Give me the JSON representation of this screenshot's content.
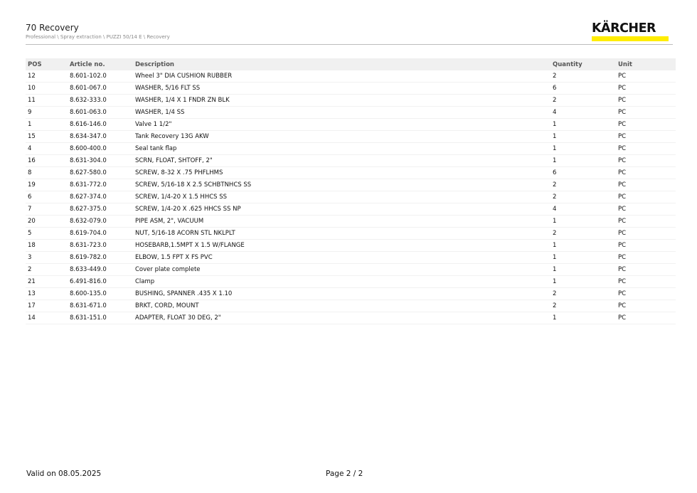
{
  "header": {
    "title": "70 Recovery",
    "breadcrumb": "Professional \\ Spray extraction \\ PUZZI 50/14 E \\ Recovery",
    "logo_text": "KÄRCHER",
    "brand_yellow": "#ffed00"
  },
  "table": {
    "columns": [
      "POS",
      "Article no.",
      "Description",
      "Quantity",
      "Unit"
    ],
    "rows": [
      [
        "12",
        "8.601-102.0",
        "Wheel 3\" DIA CUSHION RUBBER",
        "2",
        "PC"
      ],
      [
        "10",
        "8.601-067.0",
        "WASHER, 5/16 FLT SS",
        "6",
        "PC"
      ],
      [
        "11",
        "8.632-333.0",
        "WASHER, 1/4 X 1 FNDR ZN BLK",
        "2",
        "PC"
      ],
      [
        "9",
        "8.601-063.0",
        "WASHER, 1/4 SS",
        "4",
        "PC"
      ],
      [
        "1",
        "8.616-146.0",
        "Valve 1 1/2\"",
        "1",
        "PC"
      ],
      [
        "15",
        "8.634-347.0",
        "Tank Recovery 13G AKW",
        "1",
        "PC"
      ],
      [
        "4",
        "8.600-400.0",
        "Seal tank flap",
        "1",
        "PC"
      ],
      [
        "16",
        "8.631-304.0",
        "SCRN, FLOAT, SHTOFF, 2\"",
        "1",
        "PC"
      ],
      [
        "8",
        "8.627-580.0",
        "SCREW, 8-32 X .75 PHFLHMS",
        "6",
        "PC"
      ],
      [
        "19",
        "8.631-772.0",
        "SCREW, 5/16-18 X 2.5 SCHBTNHCS SS",
        "2",
        "PC"
      ],
      [
        "6",
        "8.627-374.0",
        "SCREW, 1/4-20 X 1.5 HHCS SS",
        "2",
        "PC"
      ],
      [
        "7",
        "8.627-375.0",
        "SCREW, 1/4-20 X .625 HHCS SS NP",
        "4",
        "PC"
      ],
      [
        "20",
        "8.632-079.0",
        "PIPE ASM, 2\", VACUUM",
        "1",
        "PC"
      ],
      [
        "5",
        "8.619-704.0",
        "NUT, 5/16-18 ACORN STL NKLPLT",
        "2",
        "PC"
      ],
      [
        "18",
        "8.631-723.0",
        "HOSEBARB,1.5MPT X 1.5 W/FLANGE",
        "1",
        "PC"
      ],
      [
        "3",
        "8.619-782.0",
        "ELBOW, 1.5 FPT X FS PVC",
        "1",
        "PC"
      ],
      [
        "2",
        "8.633-449.0",
        "Cover plate complete",
        "1",
        "PC"
      ],
      [
        "21",
        "6.491-816.0",
        "Clamp",
        "1",
        "PC"
      ],
      [
        "13",
        "8.600-135.0",
        "BUSHING, SPANNER .435 X 1.10",
        "2",
        "PC"
      ],
      [
        "17",
        "8.631-671.0",
        "BRKT, CORD, MOUNT",
        "2",
        "PC"
      ],
      [
        "14",
        "8.631-151.0",
        "ADAPTER, FLOAT 30 DEG, 2\"",
        "1",
        "PC"
      ]
    ]
  },
  "footer": {
    "valid_text": "Valid on 08.05.2025",
    "page_text": "Page 2 / 2"
  }
}
